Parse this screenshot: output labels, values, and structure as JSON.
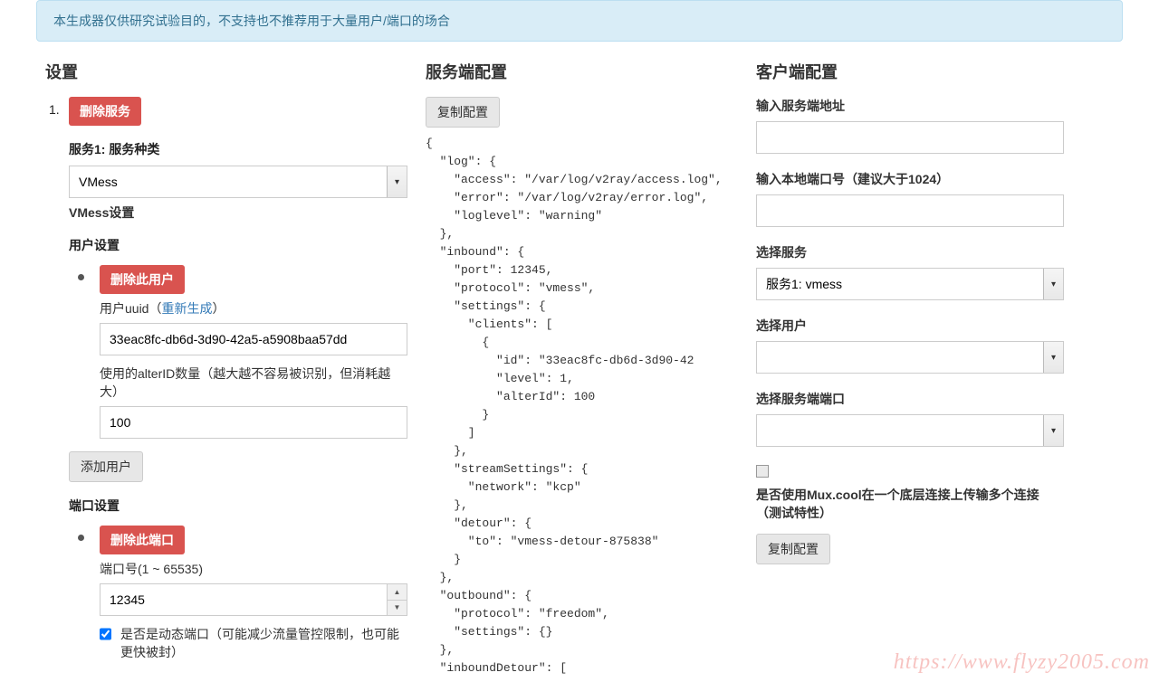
{
  "alert": "本生成器仅供研究试验目的，不支持也不推荐用于大量用户/端口的场合",
  "settings": {
    "heading": "设置",
    "marker": "1.",
    "deleteServiceBtn": "删除服务",
    "service1Label": "服务1: 服务种类",
    "serviceTypeValue": "VMess",
    "vmessHeading": "VMess设置",
    "userSettingsHeading": "用户设置",
    "deleteUserBtn": "删除此用户",
    "uuidLabelPrefix": "用户uuid（",
    "regenLink": "重新生成",
    "uuidLabelSuffix": "）",
    "uuidValue": "33eac8fc-db6d-3d90-42a5-a5908baa57dd",
    "alterIdLabel": "使用的alterID数量（越大越不容易被识别，但消耗越大）",
    "alterIdValue": "100",
    "addUserBtn": "添加用户",
    "portSettingsHeading": "端口设置",
    "deletePortBtn": "删除此端口",
    "portLabel": "端口号(1 ~ 65535)",
    "portValue": "12345",
    "dynamicPortLabel": "是否是动态端口（可能减少流量管控限制，也可能更快被封）"
  },
  "server": {
    "heading": "服务端配置",
    "copyBtn": "复制配置",
    "code": "{\n  \"log\": {\n    \"access\": \"/var/log/v2ray/access.log\",\n    \"error\": \"/var/log/v2ray/error.log\",\n    \"loglevel\": \"warning\"\n  },\n  \"inbound\": {\n    \"port\": 12345,\n    \"protocol\": \"vmess\",\n    \"settings\": {\n      \"clients\": [\n        {\n          \"id\": \"33eac8fc-db6d-3d90-42\n          \"level\": 1,\n          \"alterId\": 100\n        }\n      ]\n    },\n    \"streamSettings\": {\n      \"network\": \"kcp\"\n    },\n    \"detour\": {\n      \"to\": \"vmess-detour-875838\"\n    }\n  },\n  \"outbound\": {\n    \"protocol\": \"freedom\",\n    \"settings\": {}\n  },\n  \"inboundDetour\": ["
  },
  "client": {
    "heading": "客户端配置",
    "serverAddrLabel": "输入服务端地址",
    "localPortLabel": "输入本地端口号（建议大于1024）",
    "selectServiceLabel": "选择服务",
    "selectServiceValue": "服务1: vmess",
    "selectUserLabel": "选择用户",
    "selectPortLabel": "选择服务端端口",
    "muxLabel": "是否使用Mux.cool在一个底层连接上传输多个连接（测试特性）",
    "copyBtn": "复制配置"
  },
  "watermark": "https://www.flyzy2005.com"
}
